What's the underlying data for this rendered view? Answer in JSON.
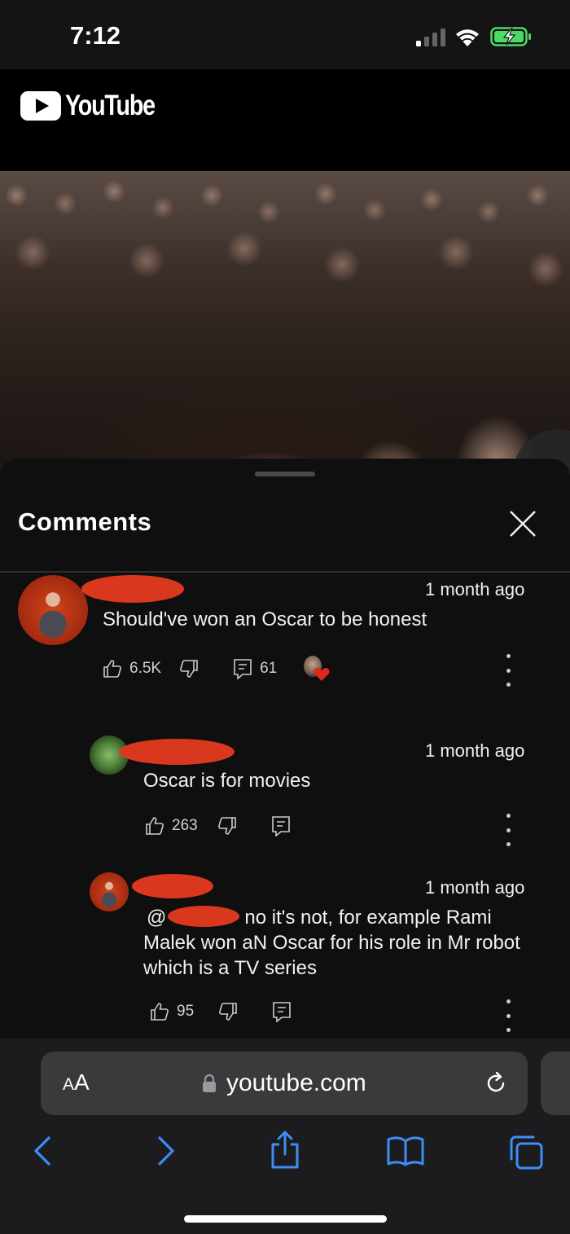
{
  "status_bar": {
    "time": "7:12"
  },
  "header": {
    "logo_text": "YouTube"
  },
  "comments": {
    "title": "Comments",
    "items": [
      {
        "time": "1 month ago",
        "text": "Should've won an Oscar to be honest",
        "likes": "6.5K",
        "replies": "61"
      },
      {
        "time": "1 month ago",
        "text": "Oscar is for movies",
        "likes": "263"
      },
      {
        "time": "1 month ago",
        "mention_prefix": "@",
        "text_line1": "no it's not, for example Rami",
        "text_line2": "Malek won aN Oscar for his role in Mr robot",
        "text_line3": "which is a TV series",
        "likes": "95"
      }
    ]
  },
  "browser": {
    "text_size_label_small": "A",
    "text_size_label_large": "A",
    "url": "youtube.com"
  },
  "colors": {
    "background": "#0f0f0f",
    "redaction": "#d9381e",
    "ios_blue": "#3e8ef7",
    "heart_red": "#e1261c"
  }
}
